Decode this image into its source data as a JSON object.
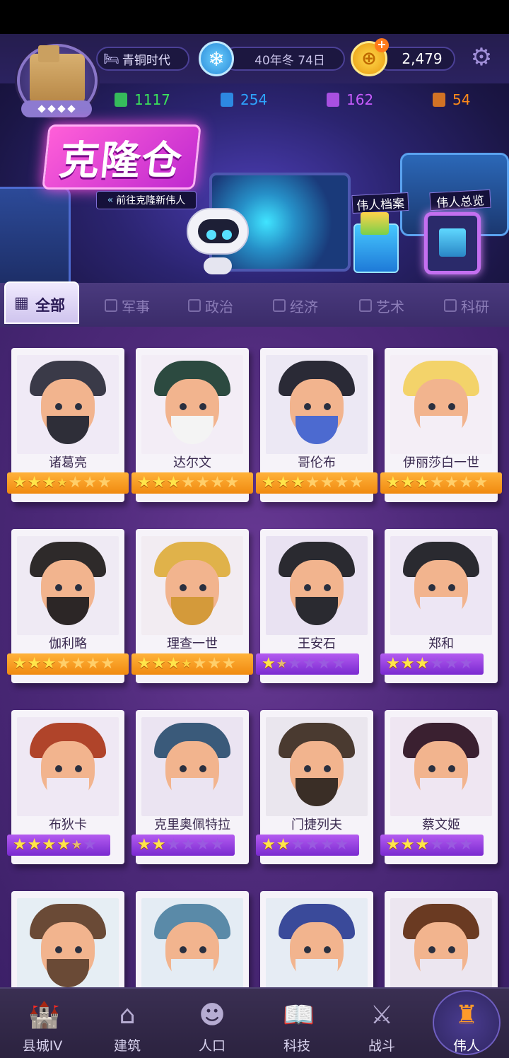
{
  "header": {
    "era_label": "青铜时代",
    "date_label": "40年冬 74日",
    "gold_value": "2,479"
  },
  "resources": [
    {
      "value": "1117",
      "color": "#3be35b"
    },
    {
      "value": "254",
      "color": "#2ea3ff"
    },
    {
      "value": "162",
      "color": "#c85cff"
    },
    {
      "value": "54",
      "color": "#ff8a1a"
    }
  ],
  "banner": {
    "clone_title": "克隆仓",
    "clone_subtitle": "前往克隆新伟人",
    "archive_label": "伟人档案",
    "overview_label": "伟人总览"
  },
  "tabs": [
    {
      "label": "全部",
      "active": true
    },
    {
      "label": "军事"
    },
    {
      "label": "政治"
    },
    {
      "label": "经济"
    },
    {
      "label": "艺术"
    },
    {
      "label": "科研"
    }
  ],
  "heroes": [
    {
      "name": "诸葛亮",
      "rarity": "orange",
      "stars": 3.5,
      "max": 7,
      "bg": "#f0eaf6",
      "hair": "#3a3a48",
      "beard": "#2e2e38"
    },
    {
      "name": "达尔文",
      "rarity": "orange",
      "stars": 3,
      "max": 7,
      "bg": "#f3edf6",
      "hair": "#2c4a40",
      "beard": "#f4f4f4"
    },
    {
      "name": "哥伦布",
      "rarity": "orange",
      "stars": 3,
      "max": 7,
      "bg": "#ece8f4",
      "hair": "#2a2a36",
      "beard": "#4c6ad0"
    },
    {
      "name": "伊丽莎白一世",
      "rarity": "orange",
      "stars": 3,
      "max": 7,
      "bg": "#f4eef6",
      "hair": "#f3d36a",
      "beard": "#f4eef6"
    },
    {
      "name": "伽利略",
      "rarity": "orange",
      "stars": 3,
      "max": 7,
      "bg": "#efeaf4",
      "hair": "#2e2a2a",
      "beard": "#2c2626"
    },
    {
      "name": "理查一世",
      "rarity": "orange",
      "stars": 3.5,
      "max": 7,
      "bg": "#f2ecf2",
      "hair": "#e0b24a",
      "beard": "#d49a3a"
    },
    {
      "name": "王安石",
      "rarity": "purple",
      "stars": 1.5,
      "max": 6,
      "bg": "#e9e2f2",
      "hair": "#2a2a30",
      "beard": "#2a2a30"
    },
    {
      "name": "郑和",
      "rarity": "purple",
      "stars": 3,
      "max": 6,
      "bg": "#ede6f4",
      "hair": "#2a2a30",
      "beard": "#ede6f4"
    },
    {
      "name": "布狄卡",
      "rarity": "purple",
      "stars": 4.5,
      "max": 6,
      "bg": "#efe8f4",
      "hair": "#b0442a",
      "beard": "#efe8f4"
    },
    {
      "name": "克里奥佩特拉",
      "rarity": "purple",
      "stars": 2,
      "max": 6,
      "bg": "#ebe4f2",
      "hair": "#3a5a7a",
      "beard": "#ebe4f2"
    },
    {
      "name": "门捷列夫",
      "rarity": "purple",
      "stars": 2,
      "max": 6,
      "bg": "#eae6ee",
      "hair": "#4a3a30",
      "beard": "#3a2e26"
    },
    {
      "name": "蔡文姬",
      "rarity": "purple",
      "stars": 3,
      "max": 6,
      "bg": "#efe6f2",
      "hair": "#3a2030",
      "beard": "#efe6f2"
    },
    {
      "name": "",
      "rarity": "none",
      "stars": 0,
      "max": 0,
      "bg": "#e6eef4",
      "hair": "#6a4a36",
      "beard": "#6a4a36"
    },
    {
      "name": "",
      "rarity": "none",
      "stars": 0,
      "max": 0,
      "bg": "#e4ecf4",
      "hair": "#5a8aa8",
      "beard": "#e4ecf4"
    },
    {
      "name": "",
      "rarity": "none",
      "stars": 0,
      "max": 0,
      "bg": "#e6ecf4",
      "hair": "#3a4a9a",
      "beard": "#e6ecf4"
    },
    {
      "name": "",
      "rarity": "none",
      "stars": 0,
      "max": 0,
      "bg": "#ece6f0",
      "hair": "#6a3a22",
      "beard": "#ece6f0"
    }
  ],
  "nav": [
    {
      "label": "县城IV",
      "icon": "castle-icon"
    },
    {
      "label": "建筑",
      "icon": "house-icon"
    },
    {
      "label": "人口",
      "icon": "person-icon"
    },
    {
      "label": "科技",
      "icon": "book-icon"
    },
    {
      "label": "战斗",
      "icon": "swords-icon"
    },
    {
      "label": "伟人",
      "icon": "statue-icon",
      "active": true
    }
  ]
}
